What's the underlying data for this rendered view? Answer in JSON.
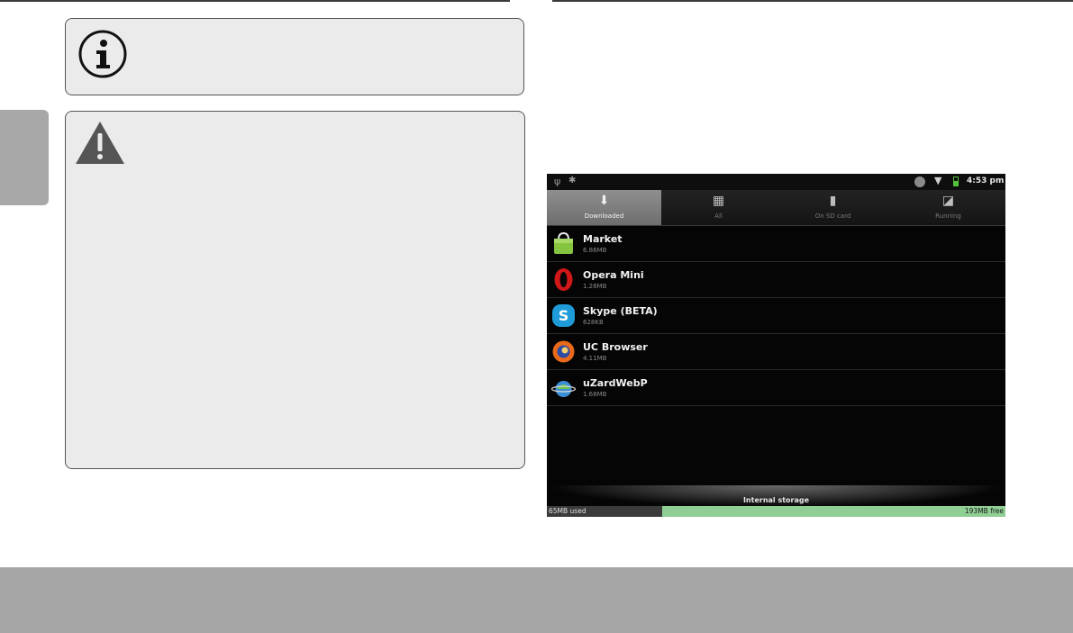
{
  "colors": {
    "page_background": "#ffffff",
    "panel_fill": "#ebebeb",
    "side_tab": "#a9a8a8",
    "footer_bar": "#a6a5a5"
  },
  "note_box": {
    "icon": "info-icon"
  },
  "warning_box": {
    "icon": "warning-icon"
  },
  "device": {
    "status_bar": {
      "left_icons": [
        "usb-icon",
        "bug-icon"
      ],
      "right_icons": [
        "globe-icon",
        "wifi-icon",
        "battery-icon"
      ],
      "time": "4:53 pm"
    },
    "tabs": [
      {
        "label": "Downloaded",
        "icon": "download-icon",
        "active": true
      },
      {
        "label": "All",
        "icon": "grid-icon",
        "active": false
      },
      {
        "label": "On SD card",
        "icon": "sd-card-icon",
        "active": false
      },
      {
        "label": "Running",
        "icon": "running-icon",
        "active": false
      }
    ],
    "apps": [
      {
        "name": "Market",
        "size": "6.86MB",
        "icon": "market-icon"
      },
      {
        "name": "Opera Mini",
        "size": "1.28MB",
        "icon": "opera-icon"
      },
      {
        "name": "Skype (BETA)",
        "size": "628KB",
        "icon": "skype-icon"
      },
      {
        "name": "UC Browser",
        "size": "4.11MB",
        "icon": "uc-browser-icon"
      },
      {
        "name": "uZardWebP",
        "size": "1.68MB",
        "icon": "uzard-icon"
      }
    ],
    "storage": {
      "title": "Internal storage",
      "used": "65MB used",
      "free": "193MB free",
      "used_fraction": 0.252
    }
  }
}
